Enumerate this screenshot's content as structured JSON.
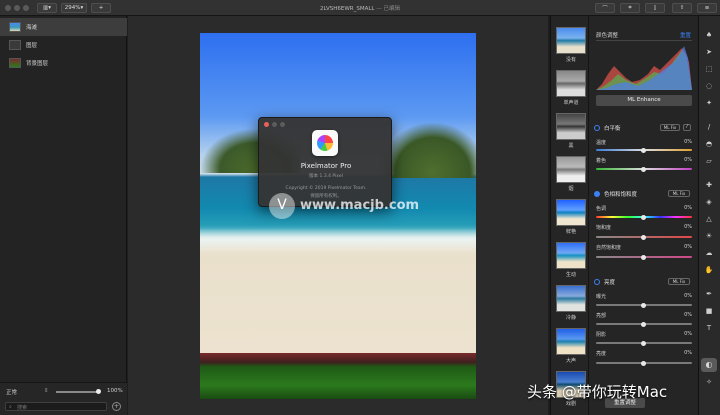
{
  "window": {
    "title": "2LVSH6EWR_SMALL",
    "edited": "— 已编辑"
  },
  "toolbar": {
    "zoom": "294%",
    "add_label": "+"
  },
  "layers": [
    {
      "name": "海滩",
      "selected": true
    },
    {
      "name": "图层",
      "selected": false
    },
    {
      "name": "背景图层",
      "selected": false
    }
  ],
  "sidebar_footer": {
    "blend_mode": "正常",
    "opacity": "100%",
    "search_placeholder": "搜索"
  },
  "about": {
    "app_name": "Pixelmator Pro",
    "version": "版本 1.3.4 Pixel",
    "copyright": "Copyright © 2019 Pixelmator Team.",
    "rights": "保留所有权利。"
  },
  "watermark": {
    "text": "www.macjb.com"
  },
  "presets": [
    "没有",
    "单声道",
    "黑",
    "烟",
    "鲜艳",
    "生动",
    "冷静",
    "大声",
    "戏剧"
  ],
  "adjust": {
    "header": "颜色调整",
    "reset": "重置",
    "ml_enhance": "ML Enhance",
    "white_balance": {
      "title": "白平衡",
      "badge": "ML Fix",
      "temp_label": "温度",
      "temp_value": "0%",
      "tint_label": "着色",
      "tint_value": "0%"
    },
    "hue_sat": {
      "title": "色相和饱和度",
      "badge": "ML Fix",
      "hue_label": "色调",
      "hue_value": "0%",
      "sat_label": "饱和度",
      "sat_value": "0%",
      "vib_label": "自然饱和度",
      "vib_value": "0%"
    },
    "lightness": {
      "title": "亮度",
      "badge": "ML Fix",
      "exposure_label": "曝光",
      "exposure_value": "0%",
      "highlights_label": "亮部",
      "highlights_value": "0%",
      "shadows_label": "阴影",
      "shadows_value": "0%",
      "brightness_label": "亮度",
      "brightness_value": "0%"
    },
    "apply": "重置调整"
  },
  "corner_watermark": "头条 @带你玩转Mac",
  "colors": {
    "accent": "#3b82f6",
    "titlebar": "#323232",
    "panel": "#252525"
  }
}
